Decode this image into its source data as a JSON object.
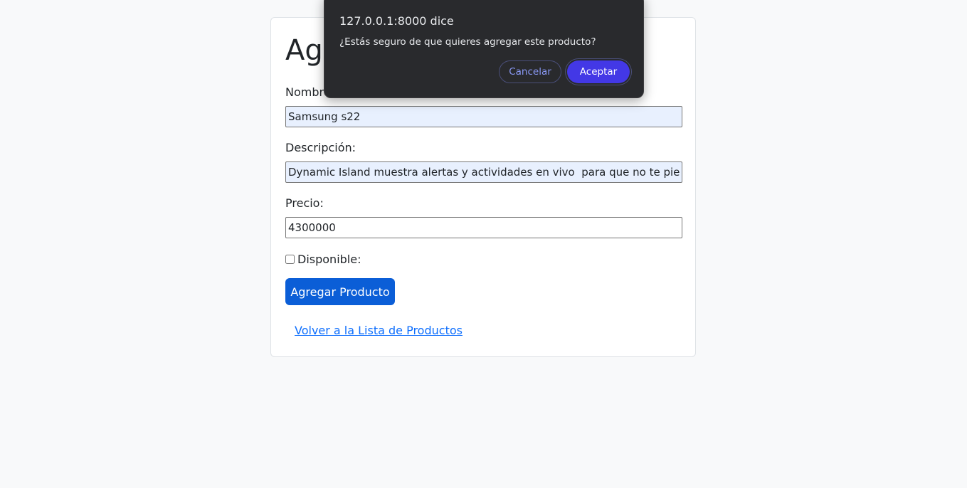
{
  "page": {
    "title": "Agregar Producto"
  },
  "form": {
    "nombre_label": "Nombre:",
    "nombre_value": "Samsung s22",
    "descripcion_label": "Descripción:",
    "descripcion_value": "Dynamic Island muestra alertas y actividades en vivo  para que no te pierdas nada",
    "precio_label": "Precio:",
    "precio_value": "4300000",
    "disponible_label": "Disponible:",
    "disponible_checked": false,
    "submit_label": "Agregar Producto",
    "back_link_label": "Volver a la Lista de Productos"
  },
  "dialog": {
    "title": "127.0.0.1:8000 dice",
    "message": "¿Estás seguro de que quieres agregar este producto?",
    "cancel_label": "Cancelar",
    "accept_label": "Aceptar"
  },
  "colors": {
    "primary": "#0b5ed7",
    "link": "#0d6efd",
    "dialog_bg": "#292a2d",
    "dialog_accept": "#4338e6"
  }
}
